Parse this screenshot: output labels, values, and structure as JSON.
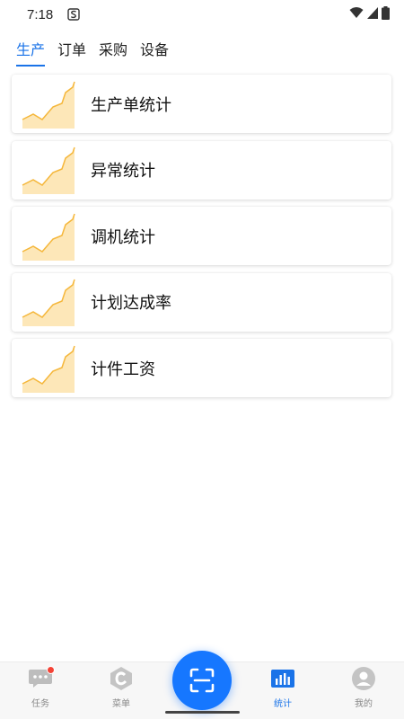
{
  "status_bar": {
    "time": "7:18"
  },
  "tabs": [
    {
      "label": "生产",
      "active": true
    },
    {
      "label": "订单",
      "active": false
    },
    {
      "label": "采购",
      "active": false
    },
    {
      "label": "设备",
      "active": false
    }
  ],
  "cards": [
    {
      "label": "生产单统计",
      "icon": "area-chart-icon"
    },
    {
      "label": "异常统计",
      "icon": "area-chart-icon"
    },
    {
      "label": "调机统计",
      "icon": "area-chart-icon"
    },
    {
      "label": "计划达成率",
      "icon": "area-chart-icon"
    },
    {
      "label": "计件工资",
      "icon": "area-chart-icon"
    }
  ],
  "bottom_nav": {
    "items": [
      {
        "label": "任务",
        "icon": "chat-icon",
        "badge": true
      },
      {
        "label": "菜单",
        "icon": "menu-logo-icon"
      },
      {
        "label": "统计",
        "icon": "bar-chart-icon",
        "active": true
      },
      {
        "label": "我的",
        "icon": "user-icon"
      }
    ],
    "scan_icon": "scan-icon"
  },
  "colors": {
    "accent": "#1a73e8",
    "scan_button": "#1677ff",
    "chart_fill": "#fde7b8",
    "chart_stroke": "#f5b73b",
    "badge": "#f44336"
  }
}
